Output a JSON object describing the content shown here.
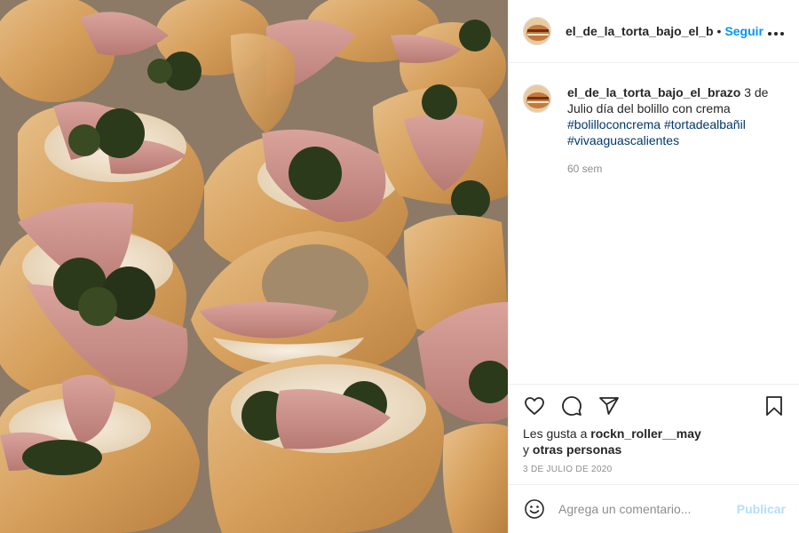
{
  "post": {
    "photo_alt": "",
    "header": {
      "username": "el_de_la_torta_bajo_el_b",
      "separator": "•",
      "follow_label": "Seguir",
      "more_icon": "more-horizontal-icon"
    },
    "caption": {
      "username": "el_de_la_torta_bajo_el_brazo",
      "text": " 3 de Julio día del bolillo con crema ",
      "hashtags": [
        "#bolilloconcrema",
        "#tortadealbañil",
        "#vivaaguascalientes"
      ],
      "age": "60 sem"
    },
    "actions": {
      "like_icon": "heart-icon",
      "comment_icon": "comment-icon",
      "share_icon": "paper-plane-icon",
      "save_icon": "bookmark-icon"
    },
    "likes": {
      "prefix": "Les gusta a ",
      "user": "rockn_roller__may",
      "middle": " y ",
      "others": "otras personas"
    },
    "date": "3 DE JULIO DE 2020",
    "comment_box": {
      "emoji_icon": "smiley-icon",
      "placeholder": "Agrega un comentario...",
      "post_label": "Publicar"
    }
  },
  "colors": {
    "link_blue": "#0095f6",
    "hashtag": "#00376b",
    "muted": "#8e8e8e",
    "disabled_blue": "#b2dffc"
  }
}
